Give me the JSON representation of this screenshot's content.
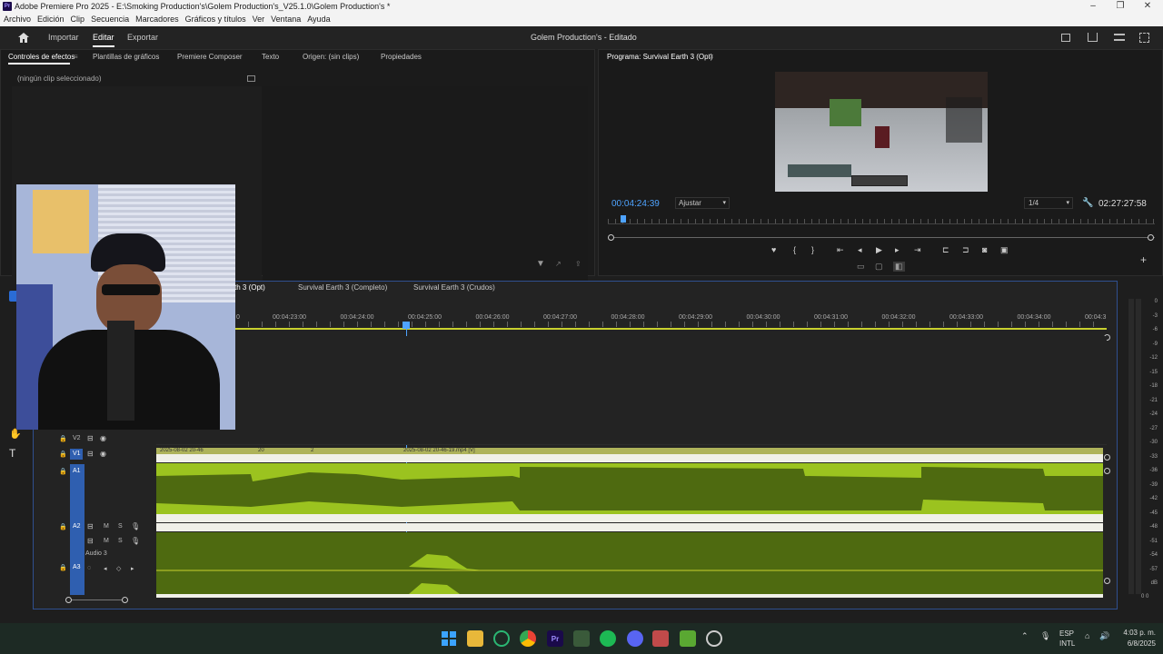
{
  "window": {
    "title": "Adobe Premiere Pro 2025 - E:\\Smoking Production's\\Golem Production's_V25.1.0\\Golem Production's *",
    "app_icon_label": "Pr",
    "minimize": "–",
    "maximize": "❐",
    "close": "✕"
  },
  "menu": [
    "Archivo",
    "Edición",
    "Clip",
    "Secuencia",
    "Marcadores",
    "Gráficos y títulos",
    "Ver",
    "Ventana",
    "Ayuda"
  ],
  "workspace": {
    "home_icon": "home-icon",
    "tabs": [
      "Importar",
      "Editar",
      "Exportar"
    ],
    "active_tab": "Editar",
    "project_title": "Golem Production's - Editado"
  },
  "source_panel": {
    "tabs": [
      "Controles de efectos",
      "Plantillas de gráficos",
      "Premiere Composer",
      "Texto",
      "Origen: (sin clips)",
      "Propiedades"
    ],
    "empty_message": "(ningún clip seleccionado)"
  },
  "program_panel": {
    "title": "Programa: Survival Earth 3 (Opt)",
    "timecode": "00:04:24:39",
    "fit_label": "Ajustar",
    "resolution": "1/4",
    "duration": "02:27:27:58"
  },
  "timeline": {
    "tabs": [
      "th 3 (Opt)",
      "Survival Earth 3 (Completo)",
      "Survival Earth 3 (Crudos)"
    ],
    "ruler": [
      "0",
      "00:04:23:00",
      "00:04:24:00",
      "00:04:25:00",
      "00:04:26:00",
      "00:04:27:00",
      "00:04:28:00",
      "00:04:29:00",
      "00:04:30:00",
      "00:04:31:00",
      "00:04:32:00",
      "00:04:33:00",
      "00:04:34:00",
      "00:04:3"
    ],
    "tracks": {
      "v2": "V2",
      "v1": "V1",
      "a1": "A1",
      "a2": "A2",
      "a3": "A3",
      "audio3_name": "Audio 3",
      "m": "M",
      "s": "S"
    },
    "clip_labels": [
      "2025-08-02 20-46",
      "20",
      "2",
      "2025-08-02 20-46-19.mp4 [V]"
    ],
    "playhead_progress": 0.263
  },
  "meter": {
    "ticks": [
      "0",
      "-3",
      "-6",
      "-9",
      "-12",
      "-15",
      "-18",
      "-21",
      "-24",
      "-27",
      "-30",
      "-33",
      "-36",
      "-39",
      "-42",
      "-45",
      "-48",
      "-51",
      "-54",
      "-57",
      "dB"
    ],
    "footer": "0 0"
  },
  "tools": {
    "text_tool": "T"
  },
  "taskbar": {
    "lang1": "ESP",
    "lang2": "INTL",
    "time": "4:03 p. m.",
    "date": "6/8/2025"
  }
}
